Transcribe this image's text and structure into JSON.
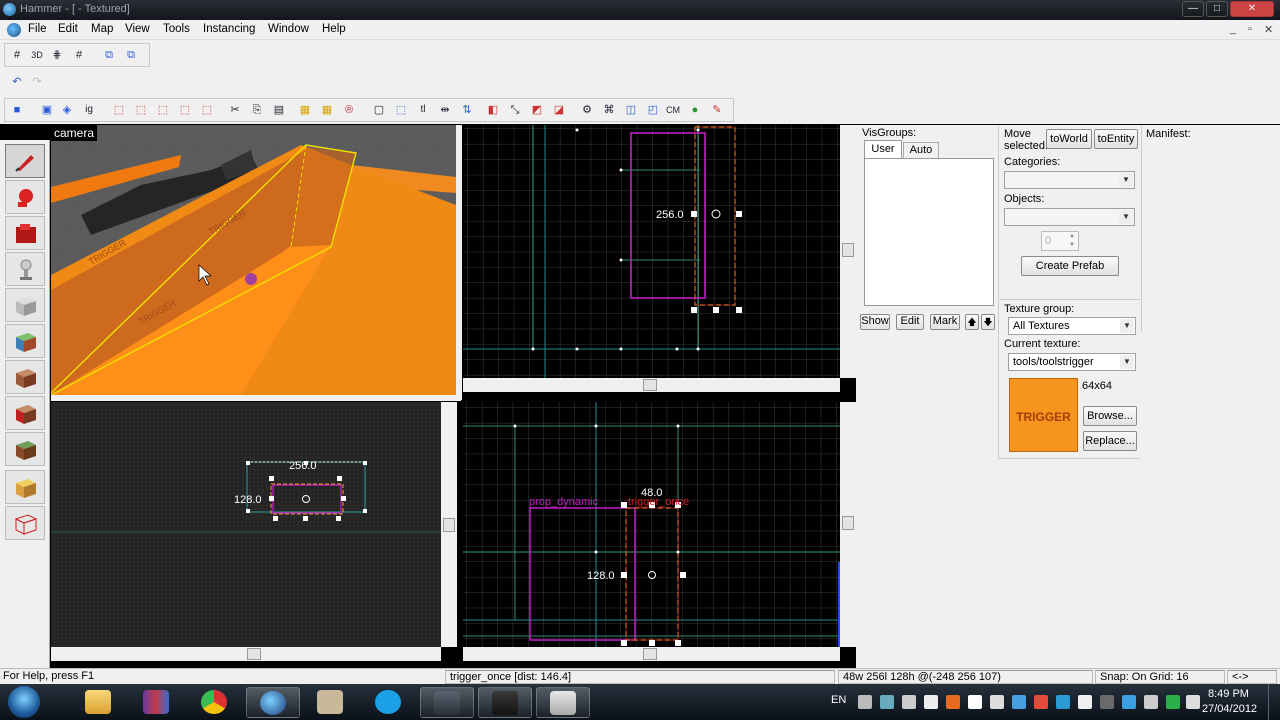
{
  "window": {
    "title": "Hammer - [ - Textured]",
    "minimize": "—",
    "maximize": "□",
    "close": "✕"
  },
  "menu": {
    "items": [
      "File",
      "Edit",
      "Map",
      "View",
      "Tools",
      "Instancing",
      "Window",
      "Help"
    ],
    "mdi_controls": [
      "_",
      "▫",
      "✕"
    ]
  },
  "toolbar": {
    "labels": [
      "3D",
      "ig",
      "tl",
      "CM"
    ]
  },
  "viewports": {
    "camera_label": "camera",
    "camera_texture_text": "TRIGGER",
    "top_right": {
      "dim_width": "256.0"
    },
    "bottom_left": {
      "dim_width": "256.0",
      "dim_height": "128.0"
    },
    "bottom_right": {
      "dim_depth": "48.0",
      "dim_height": "128.0",
      "label_prop": "prop_dynamic",
      "label_trigger": "trigger_once"
    }
  },
  "visgroups": {
    "title": "VisGroups:",
    "tabs": [
      "User",
      "Auto"
    ],
    "buttons": [
      "Show",
      "Edit",
      "Mark",
      "🡅",
      "🡇"
    ]
  },
  "move_panel": {
    "label_line1": "Move",
    "label_line2": "selected:",
    "to_world": "toWorld",
    "to_entity": "toEntity",
    "categories_label": "Categories:",
    "objects_label": "Objects:",
    "stepper_value": "0",
    "create_prefab": "Create Prefab"
  },
  "manifest": {
    "title": "Manifest:"
  },
  "texture": {
    "group_label": "Texture group:",
    "group_value": "All Textures",
    "current_label": "Current texture:",
    "current_value": "tools/toolstrigger",
    "size": "64x64",
    "preview_text": "TRIGGER",
    "browse": "Browse...",
    "replace": "Replace..."
  },
  "status": {
    "help": "For Help, press F1",
    "selection": "trigger_once  [dist: 146.4]",
    "dimensions": "48w 256l 128h @(-248 256 107)",
    "snap": "Snap: On Grid: 16",
    "zoom": "<->"
  },
  "taskbar": {
    "language": "EN",
    "time": "8:49 PM",
    "date": "27/04/2012"
  },
  "colors": {
    "grid_bg": "#000000",
    "trigger_orange": "#f7941d",
    "selection_yellow": "#f0e000",
    "brush_magenta": "#c020c0"
  }
}
